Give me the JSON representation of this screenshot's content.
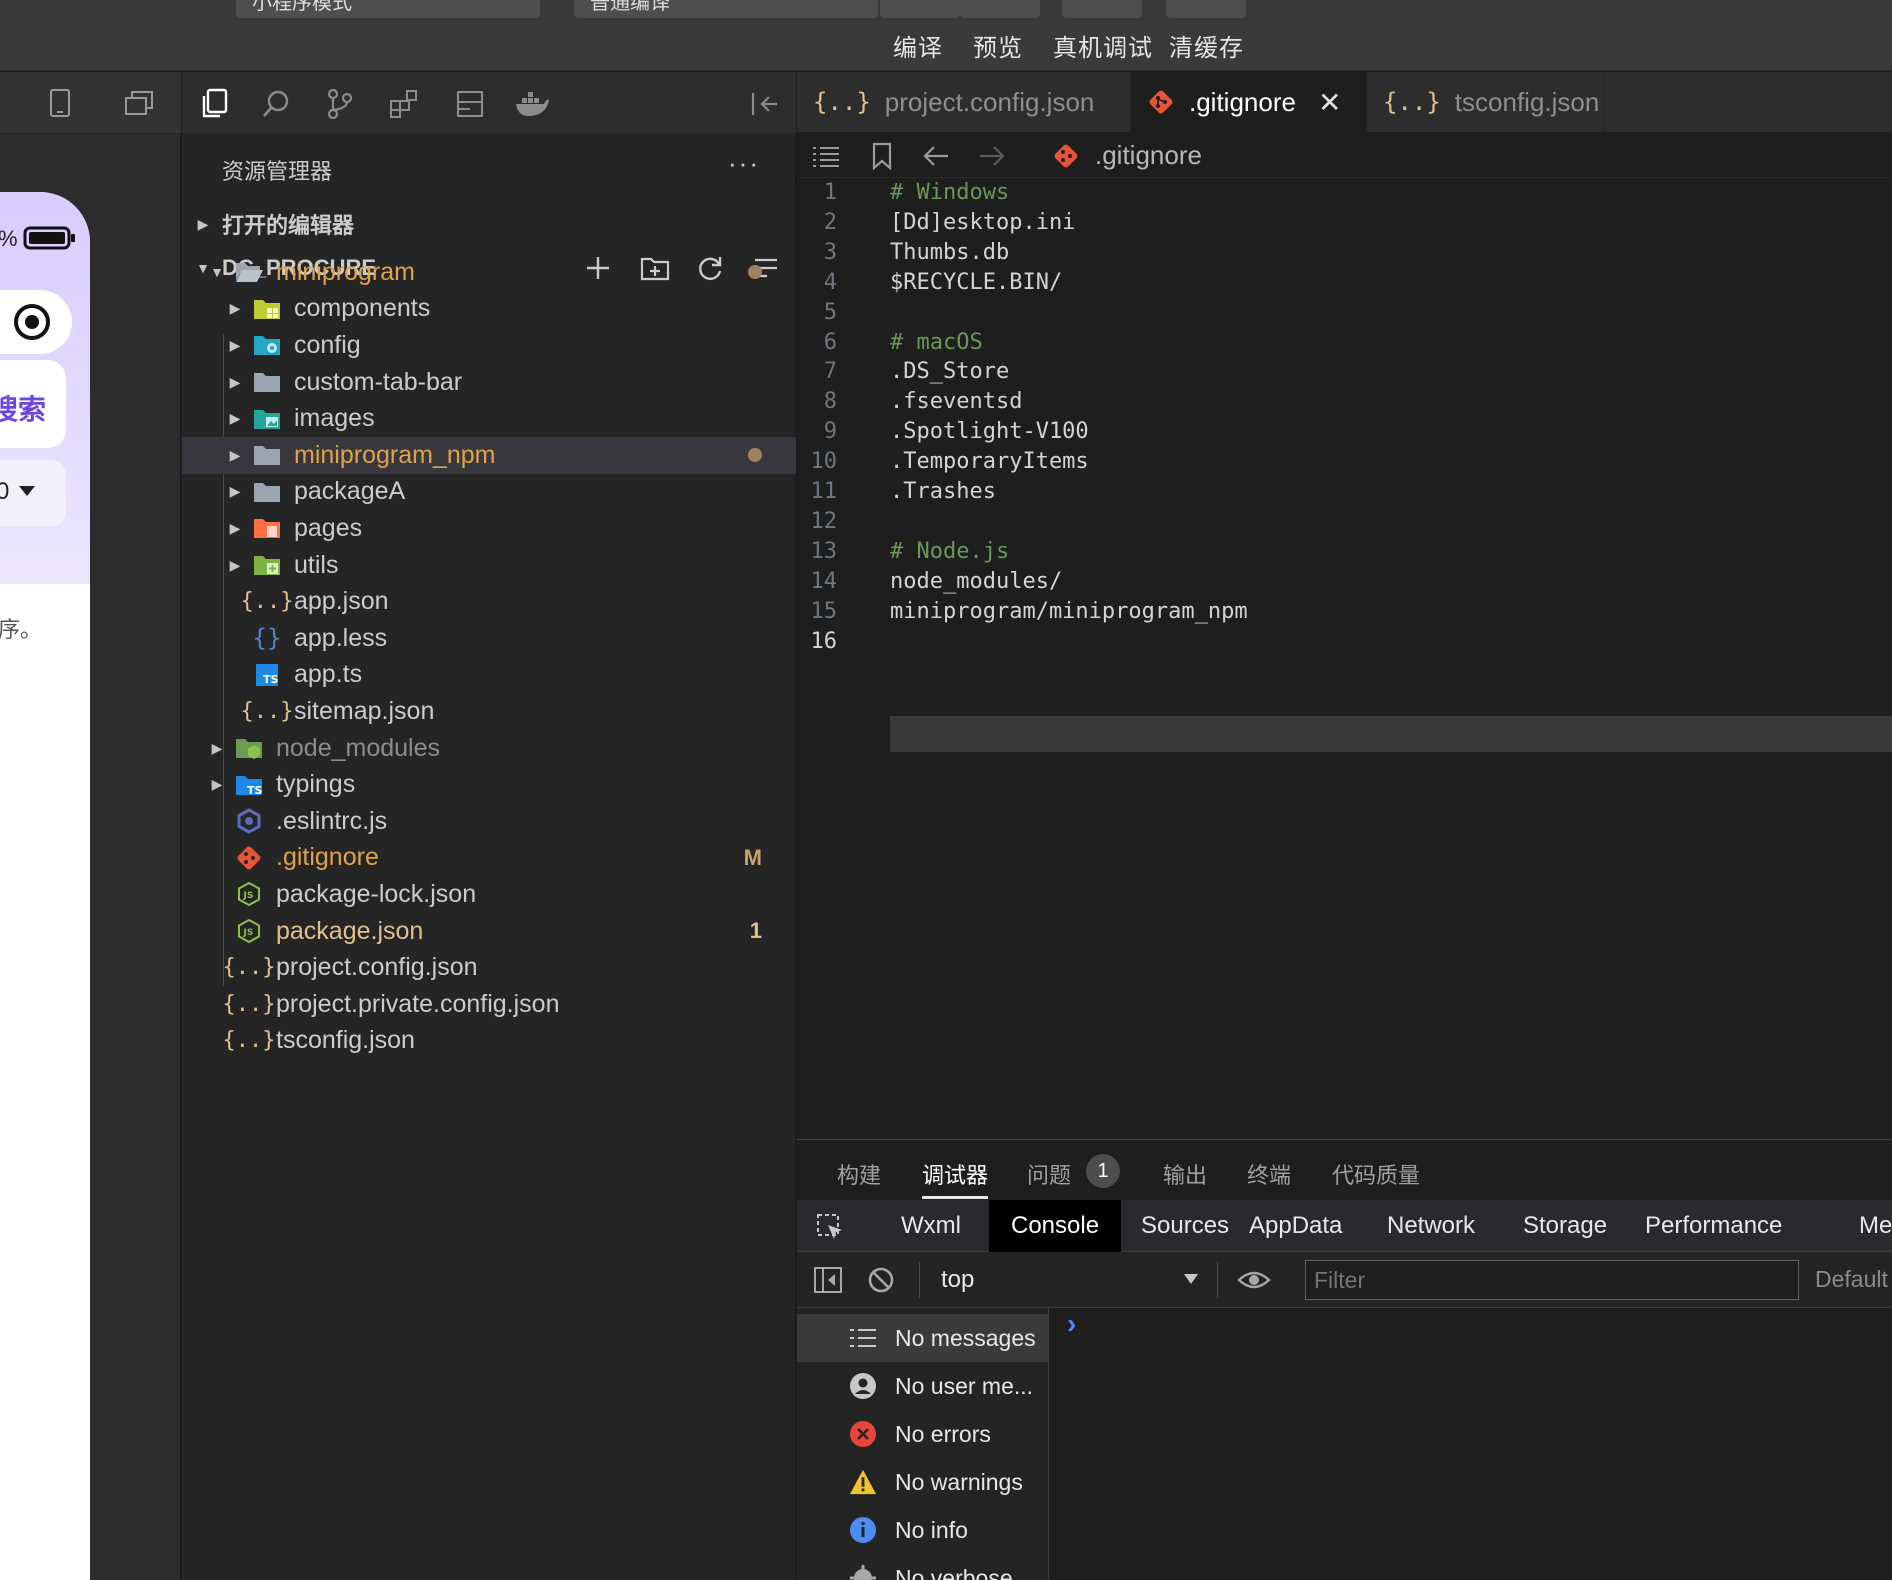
{
  "toolbar": {
    "mode_select": "小程序模式",
    "compile_select": "普通编译",
    "buttons": [
      "编译",
      "预览",
      "真机调试",
      "清缓存"
    ]
  },
  "simulator": {
    "battery_text": "%",
    "search_text": "搜索",
    "dropdown_text": "0",
    "hint_text": "序。"
  },
  "explorer": {
    "title": "资源管理器",
    "more": "···",
    "open_editors": "打开的编辑器",
    "project_name": "DC_PROCURE",
    "items": [
      {
        "label": "miniprogram",
        "icon": "folder-open-icon",
        "color": "#e2a24a",
        "decoration": "dot"
      },
      {
        "label": "components",
        "icon": "folder-components-icon",
        "color": "#cccccc"
      },
      {
        "label": "config",
        "icon": "folder-config-icon",
        "color": "#cccccc"
      },
      {
        "label": "custom-tab-bar",
        "icon": "folder-icon",
        "color": "#cccccc"
      },
      {
        "label": "images",
        "icon": "folder-images-icon",
        "color": "#cccccc"
      },
      {
        "label": "miniprogram_npm",
        "icon": "folder-icon",
        "color": "#e2a24a",
        "decoration": "dot"
      },
      {
        "label": "packageA",
        "icon": "folder-icon",
        "color": "#cccccc"
      },
      {
        "label": "pages",
        "icon": "folder-pages-icon",
        "color": "#cccccc"
      },
      {
        "label": "utils",
        "icon": "folder-utils-icon",
        "color": "#cccccc"
      },
      {
        "label": "app.json",
        "icon": "json-icon",
        "color": "#cccccc"
      },
      {
        "label": "app.less",
        "icon": "less-icon",
        "color": "#cccccc"
      },
      {
        "label": "app.ts",
        "icon": "typescript-icon",
        "color": "#cccccc"
      },
      {
        "label": "sitemap.json",
        "icon": "json-icon",
        "color": "#cccccc"
      },
      {
        "label": "node_modules",
        "icon": "folder-node-icon",
        "color": "#8c8c8c"
      },
      {
        "label": "typings",
        "icon": "folder-typings-icon",
        "color": "#cccccc"
      },
      {
        "label": ".eslintrc.js",
        "icon": "eslint-icon",
        "color": "#cccccc"
      },
      {
        "label": ".gitignore",
        "icon": "git-icon",
        "color": "#e2a24a",
        "decoration": "M"
      },
      {
        "label": "package-lock.json",
        "icon": "nodejs-icon",
        "color": "#cccccc"
      },
      {
        "label": "package.json",
        "icon": "nodejs-icon",
        "color": "#e2c08d",
        "decoration": "1"
      },
      {
        "label": "project.config.json",
        "icon": "json-icon",
        "color": "#cccccc"
      },
      {
        "label": "project.private.config.json",
        "icon": "json-icon",
        "color": "#cccccc"
      },
      {
        "label": "tsconfig.json",
        "icon": "json-icon",
        "color": "#cccccc"
      }
    ]
  },
  "tabs": [
    {
      "label": "project.config.json",
      "active": false
    },
    {
      "label": ".gitignore",
      "active": true,
      "close": "✕"
    },
    {
      "label": "tsconfig.json",
      "active": false
    }
  ],
  "breadcrumb": {
    "file": ".gitignore"
  },
  "code_lines": [
    {
      "n": "1",
      "text": "# Windows",
      "comment": true
    },
    {
      "n": "2",
      "text": "[Dd]esktop.ini",
      "comment": false
    },
    {
      "n": "3",
      "text": "Thumbs.db",
      "comment": false
    },
    {
      "n": "4",
      "text": "$RECYCLE.BIN/",
      "comment": false
    },
    {
      "n": "5",
      "text": "",
      "comment": false
    },
    {
      "n": "6",
      "text": "# macOS",
      "comment": true
    },
    {
      "n": "7",
      "text": ".DS_Store",
      "comment": false
    },
    {
      "n": "8",
      "text": ".fseventsd",
      "comment": false
    },
    {
      "n": "9",
      "text": ".Spotlight-V100",
      "comment": false
    },
    {
      "n": "10",
      "text": ".TemporaryItems",
      "comment": false
    },
    {
      "n": "11",
      "text": ".Trashes",
      "comment": false
    },
    {
      "n": "12",
      "text": "",
      "comment": false
    },
    {
      "n": "13",
      "text": "# Node.js",
      "comment": true
    },
    {
      "n": "14",
      "text": "node_modules/",
      "comment": false
    },
    {
      "n": "15",
      "text": "miniprogram/miniprogram_npm",
      "comment": false
    },
    {
      "n": "16",
      "text": "",
      "comment": false
    }
  ],
  "panel": {
    "tabs": [
      "构建",
      "调试器",
      "问题",
      "输出",
      "终端",
      "代码质量"
    ],
    "problems_count": "1",
    "devtools_tabs": [
      "Wxml",
      "Console",
      "Sources",
      "AppData",
      "Network",
      "Storage",
      "Performance",
      "Me"
    ],
    "context": "top",
    "filter_placeholder": "Filter",
    "levels": "Default",
    "messages": [
      {
        "label": "No messages",
        "icon": "list-icon"
      },
      {
        "label": "No user me...",
        "icon": "user-icon"
      },
      {
        "label": "No errors",
        "icon": "error-icon"
      },
      {
        "label": "No warnings",
        "icon": "warning-icon"
      },
      {
        "label": "No info",
        "icon": "info-icon"
      },
      {
        "label": "No verbose",
        "icon": "verbose-icon"
      }
    ],
    "prompt": "›"
  },
  "colors": {
    "accent_orange": "#e2a24a",
    "git_red": "#e8543a",
    "comment_green": "#6a9955"
  }
}
